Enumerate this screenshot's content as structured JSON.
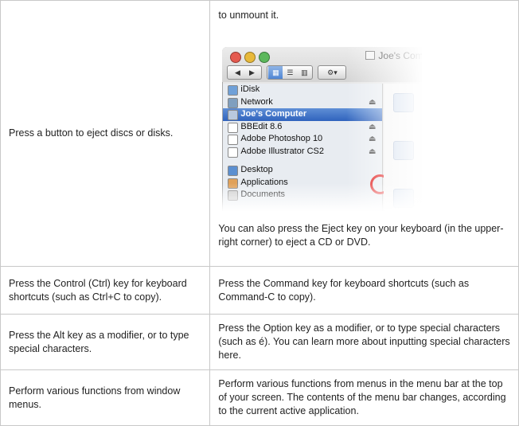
{
  "rows": [
    {
      "left": "Press a button to eject discs or disks.",
      "right_intro": "to unmount it.",
      "right_note": "You can also press the Eject key on your keyboard (in the upper-right corner) to eject a CD or DVD."
    },
    {
      "left": "Press the Control (Ctrl) key for keyboard shortcuts (such as Ctrl+C to copy).",
      "right": "Press the Command key for keyboard shortcuts (such as Command-C to copy)."
    },
    {
      "left": "Press the Alt key as a modifier, or to type special characters.",
      "right": "Press the Option key as a modifier, or to type special characters (such as é). You can learn more about inputting special characters here."
    },
    {
      "left": "Perform various functions from window menus.",
      "right": "Perform various functions from menus in the menu bar at the top of your screen. The contents of the menu bar changes, according to the current active application."
    }
  ],
  "finder": {
    "window_title": "Joe's Computer",
    "sidebar": [
      {
        "label": "iDisk",
        "icon": "idisk-icon",
        "eject": false,
        "selected": false
      },
      {
        "label": "Network",
        "icon": "network-icon",
        "eject": true,
        "selected": false
      },
      {
        "label": "Joe's Computer",
        "icon": "computer-icon",
        "eject": false,
        "selected": true
      },
      {
        "label": "BBEdit 8.6",
        "icon": "disk-icon",
        "eject": true,
        "selected": false
      },
      {
        "label": "Adobe Photoshop 10",
        "icon": "disk-icon",
        "eject": true,
        "selected": false
      },
      {
        "label": "Adobe Illustrator CS2",
        "icon": "disk-icon",
        "eject": true,
        "selected": false
      },
      {
        "label": "Desktop",
        "icon": "desktop-icon",
        "eject": false,
        "selected": false
      },
      {
        "label": "Applications",
        "icon": "applications-icon",
        "eject": false,
        "selected": false
      },
      {
        "label": "Documents",
        "icon": "documents-icon",
        "eject": false,
        "selected": false
      }
    ],
    "eject_glyph": "⏏",
    "highlight_color": "#e01010",
    "selection_color": "#2f63bd"
  }
}
